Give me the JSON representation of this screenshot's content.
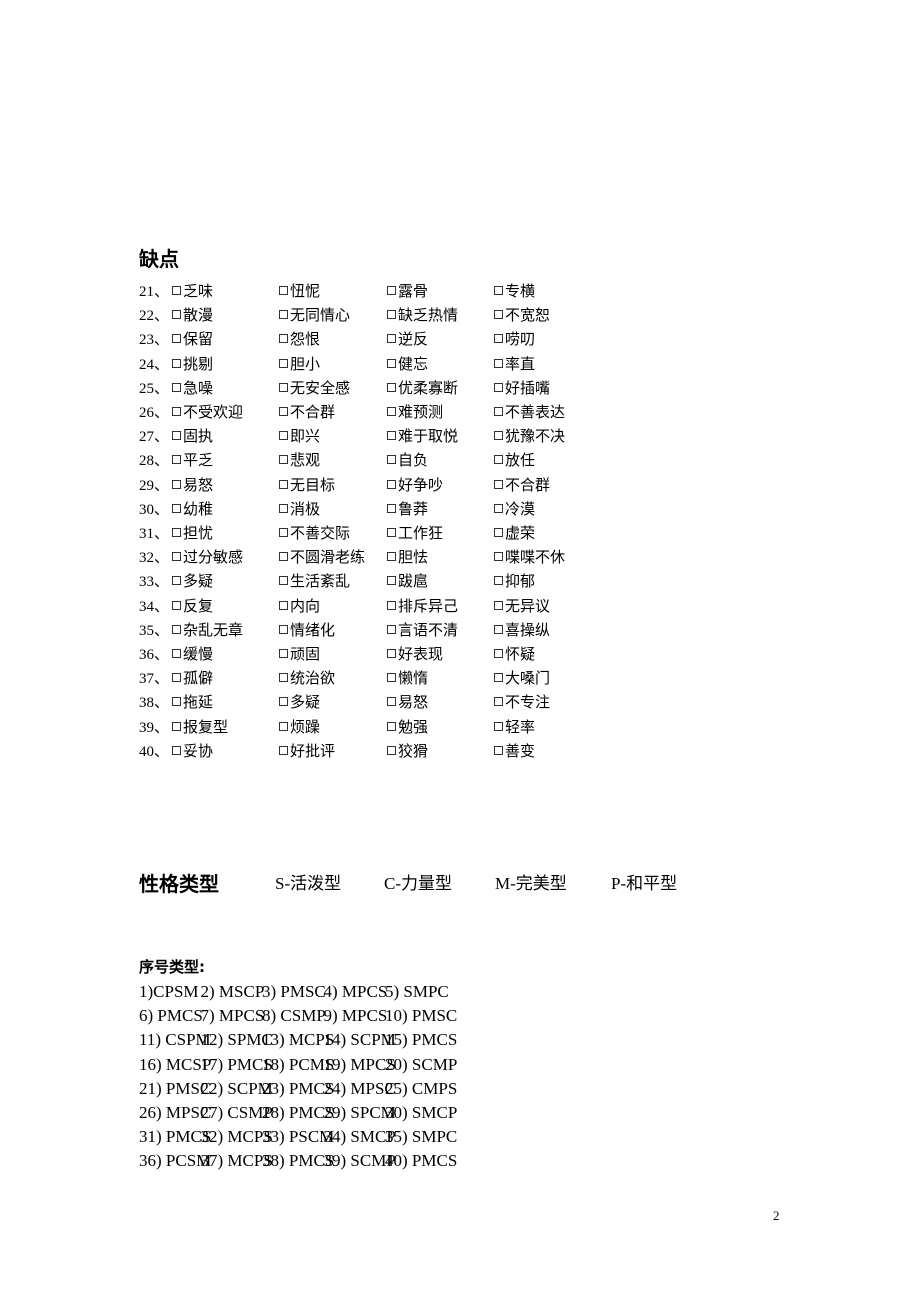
{
  "weaknesses": {
    "title": "缺点",
    "rows": [
      {
        "num": "21、",
        "items": [
          "乏味",
          "忸怩",
          "露骨",
          "专横"
        ]
      },
      {
        "num": "22、",
        "items": [
          "散漫",
          "无同情心",
          "缺乏热情",
          "不宽恕"
        ]
      },
      {
        "num": "23、",
        "items": [
          "保留",
          "怨恨",
          "逆反",
          "唠叨"
        ]
      },
      {
        "num": "24、",
        "items": [
          "挑剔",
          "胆小",
          "健忘",
          "率直"
        ]
      },
      {
        "num": "25、",
        "items": [
          "急噪",
          "无安全感",
          "优柔寡断",
          "好插嘴"
        ]
      },
      {
        "num": "26、",
        "items": [
          "不受欢迎",
          "不合群",
          "难预测",
          "不善表达"
        ]
      },
      {
        "num": "27、",
        "items": [
          "固执",
          "即兴",
          "难于取悦",
          "犹豫不决"
        ]
      },
      {
        "num": "28、",
        "items": [
          "平乏",
          "悲观",
          "自负",
          "放任"
        ]
      },
      {
        "num": "29、",
        "items": [
          "易怒",
          "无目标",
          "好争吵",
          "不合群"
        ]
      },
      {
        "num": "30、",
        "items": [
          "幼稚",
          "消极",
          "鲁莽",
          "冷漠"
        ]
      },
      {
        "num": "31、",
        "items": [
          "担忧",
          "不善交际",
          "工作狂",
          "虚荣"
        ]
      },
      {
        "num": "32、",
        "items": [
          "过分敏感",
          "不圆滑老练",
          "胆怯",
          "喋喋不休"
        ]
      },
      {
        "num": "33、",
        "items": [
          "多疑",
          "生活紊乱",
          "跋扈",
          "抑郁"
        ]
      },
      {
        "num": "34、",
        "items": [
          "反复",
          "内向",
          "排斥异己",
          "无异议"
        ]
      },
      {
        "num": "35、",
        "items": [
          "杂乱无章",
          "情绪化",
          "言语不清",
          "喜操纵"
        ]
      },
      {
        "num": "36、",
        "items": [
          "缓慢",
          "顽固",
          "好表现",
          "怀疑"
        ]
      },
      {
        "num": "37、",
        "items": [
          "孤僻",
          "统治欲",
          "懒惰",
          "大嗓门"
        ]
      },
      {
        "num": "38、",
        "items": [
          "拖延",
          "多疑",
          "易怒",
          "不专注"
        ]
      },
      {
        "num": "39、",
        "items": [
          "报复型",
          "烦躁",
          "勉强",
          "轻率"
        ]
      },
      {
        "num": "40、",
        "items": [
          "妥协",
          "好批评",
          "狡猾",
          "善变"
        ]
      }
    ]
  },
  "personality_types": {
    "title": "性格类型",
    "types": [
      "S-活泼型",
      "C-力量型",
      "M-完美型",
      "P-和平型"
    ]
  },
  "sequence_types": {
    "title": "序号类型:",
    "rows": [
      [
        "1)CPSM",
        "2) MSCP",
        "3) PMSC",
        "4) MPCS",
        "5) SMPC"
      ],
      [
        "6) PMCS",
        "7) MPCS",
        "8) CSMP",
        "9) MPCS",
        "10) PMSC"
      ],
      [
        "11) CSPM",
        "12) SPMC",
        "13) MCPS",
        "14) SCPM",
        "15) PMCS"
      ],
      [
        "16) MCSP",
        "17) PMCS",
        "18) PCMS",
        "19) MPCS",
        "20) SCMP"
      ],
      [
        "21) PMSC",
        "22) SCPM",
        "23) PMCS",
        "24) MPSC",
        "25) CMPS"
      ],
      [
        "26) MPSC",
        "27) CSMP",
        "28) PMCS",
        "29) SPCM",
        "30) SMCP"
      ],
      [
        "31) PMCS",
        "32) MCPS",
        "33) PSCM",
        "34) SMCP",
        "35) SMPC"
      ],
      [
        "36) PCSM",
        "37) MCPS",
        "38) PMCS",
        "39) SCMP",
        "40) PMCS"
      ]
    ]
  },
  "page_number": "2"
}
